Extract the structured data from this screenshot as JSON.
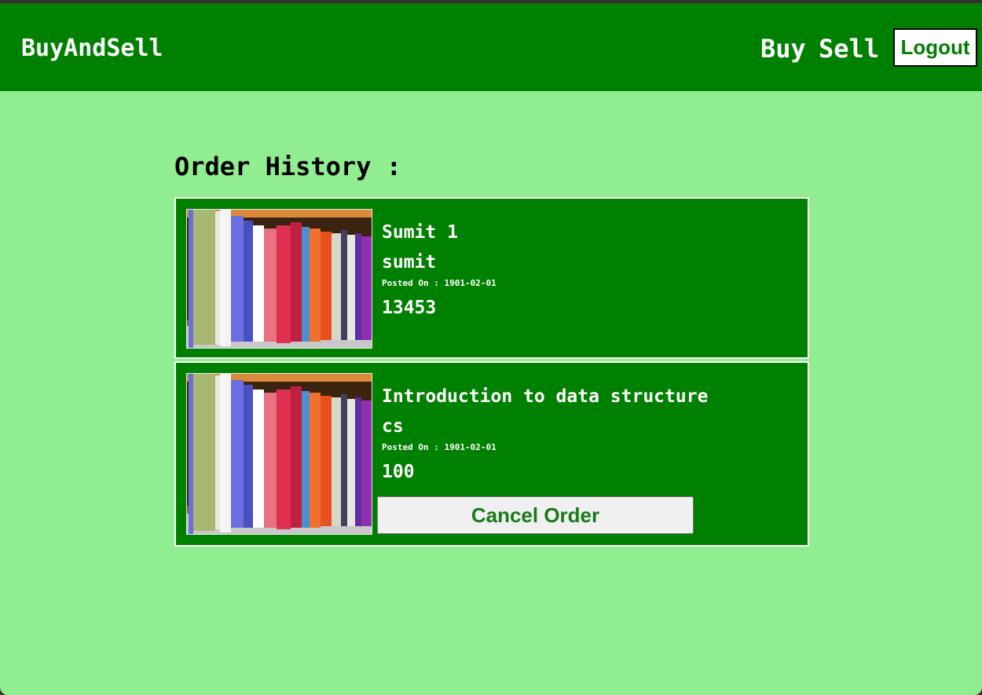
{
  "navbar": {
    "brand": "BuyAndSell",
    "buy_label": "Buy",
    "sell_label": "Sell",
    "logout_label": "Logout"
  },
  "main": {
    "heading": "Order History :",
    "orders": [
      {
        "title": "Sumit 1",
        "author": "sumit",
        "posted": "Posted On : 1901-02-01",
        "price": "13453",
        "image": "bookshelf-image"
      },
      {
        "title": "Introduction to data structure",
        "author": "cs",
        "posted": "Posted On : 1901-02-01",
        "price": "100",
        "image": "bookshelf-image",
        "cancel_label": "Cancel Order"
      }
    ]
  },
  "colors": {
    "page_background": "#90ee90",
    "navbar_background": "#008000",
    "card_background": "#008000",
    "card_border": "#ffffff",
    "logout_text": "#008000",
    "cancel_text": "#1a7a1a"
  }
}
